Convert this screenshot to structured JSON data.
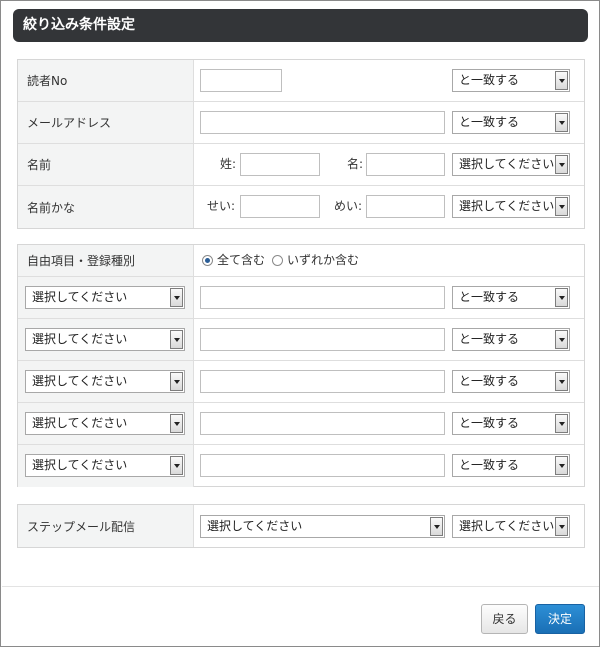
{
  "header": {
    "title": "絞り込み条件設定"
  },
  "match_label": "と一致する",
  "select_placeholder": "選択してください",
  "section1": {
    "reader_no": "読者No",
    "email": "メールアドレス",
    "name": "名前",
    "name_kana": "名前かな",
    "sei_label": "姓:",
    "mei_label": "名:",
    "sei_kana_label": "せい:",
    "mei_kana_label": "めい:"
  },
  "section2": {
    "title": "自由項目・登録種別",
    "radio_all": "全て含む",
    "radio_any": "いずれか含む"
  },
  "section3": {
    "step_mail": "ステップメール配信"
  },
  "buttons": {
    "back": "戻る",
    "confirm": "決定"
  }
}
